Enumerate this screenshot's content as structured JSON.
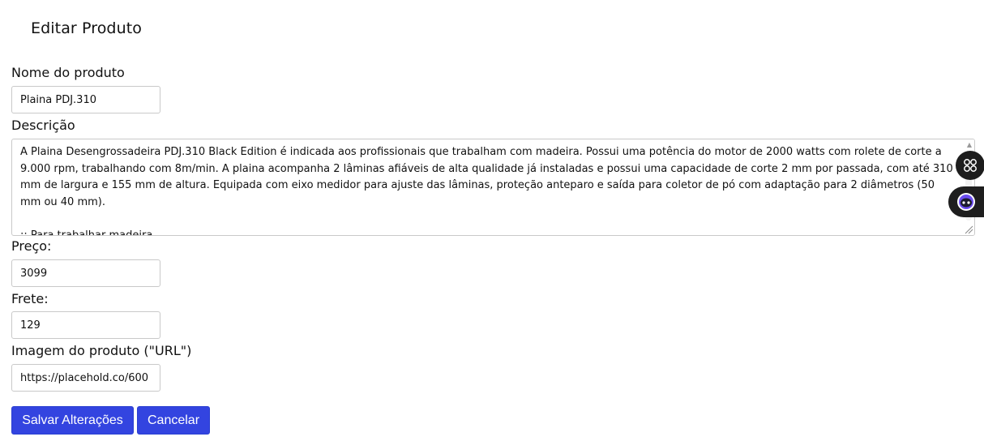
{
  "page": {
    "title": "Editar Produto"
  },
  "form": {
    "name": {
      "label": "Nome do produto",
      "value": "Plaina PDJ.310"
    },
    "description": {
      "label": "Descrição",
      "value": "A Plaina Desengrossadeira PDJ.310 Black Edition é indicada aos profissionais que trabalham com madeira. Possui uma potência do motor de 2000 watts com rolete de corte a 9.000 rpm, trabalhando com 8m/min. A plaina acompanha 2 lâminas afiáveis de alta qualidade já instaladas e possui uma capacidade de corte 2 mm por passada, com até 310 mm de largura e 155 mm de altura. Equipada com eixo medidor para ajuste das lâminas, proteção anteparo e saída para coletor de pó com adaptação para 2 diâmetros (50 mm ou 40 mm).\n\n:: Para trabalhar madeira"
    },
    "price": {
      "label": "Preço:",
      "value": "3099"
    },
    "shipping": {
      "label": "Frete:",
      "value": "129"
    },
    "image": {
      "label": "Imagem do produto (\"URL\")",
      "value": "https://placehold.co/600"
    }
  },
  "actions": {
    "save_label": "Salvar Alterações",
    "cancel_label": "Cancelar"
  },
  "floating": {
    "grid_icon": "grid-icon",
    "bot_icon": "assistant-bot-icon"
  },
  "colors": {
    "button_bg": "#3344e0",
    "floating_bg": "#1d1d1d"
  }
}
